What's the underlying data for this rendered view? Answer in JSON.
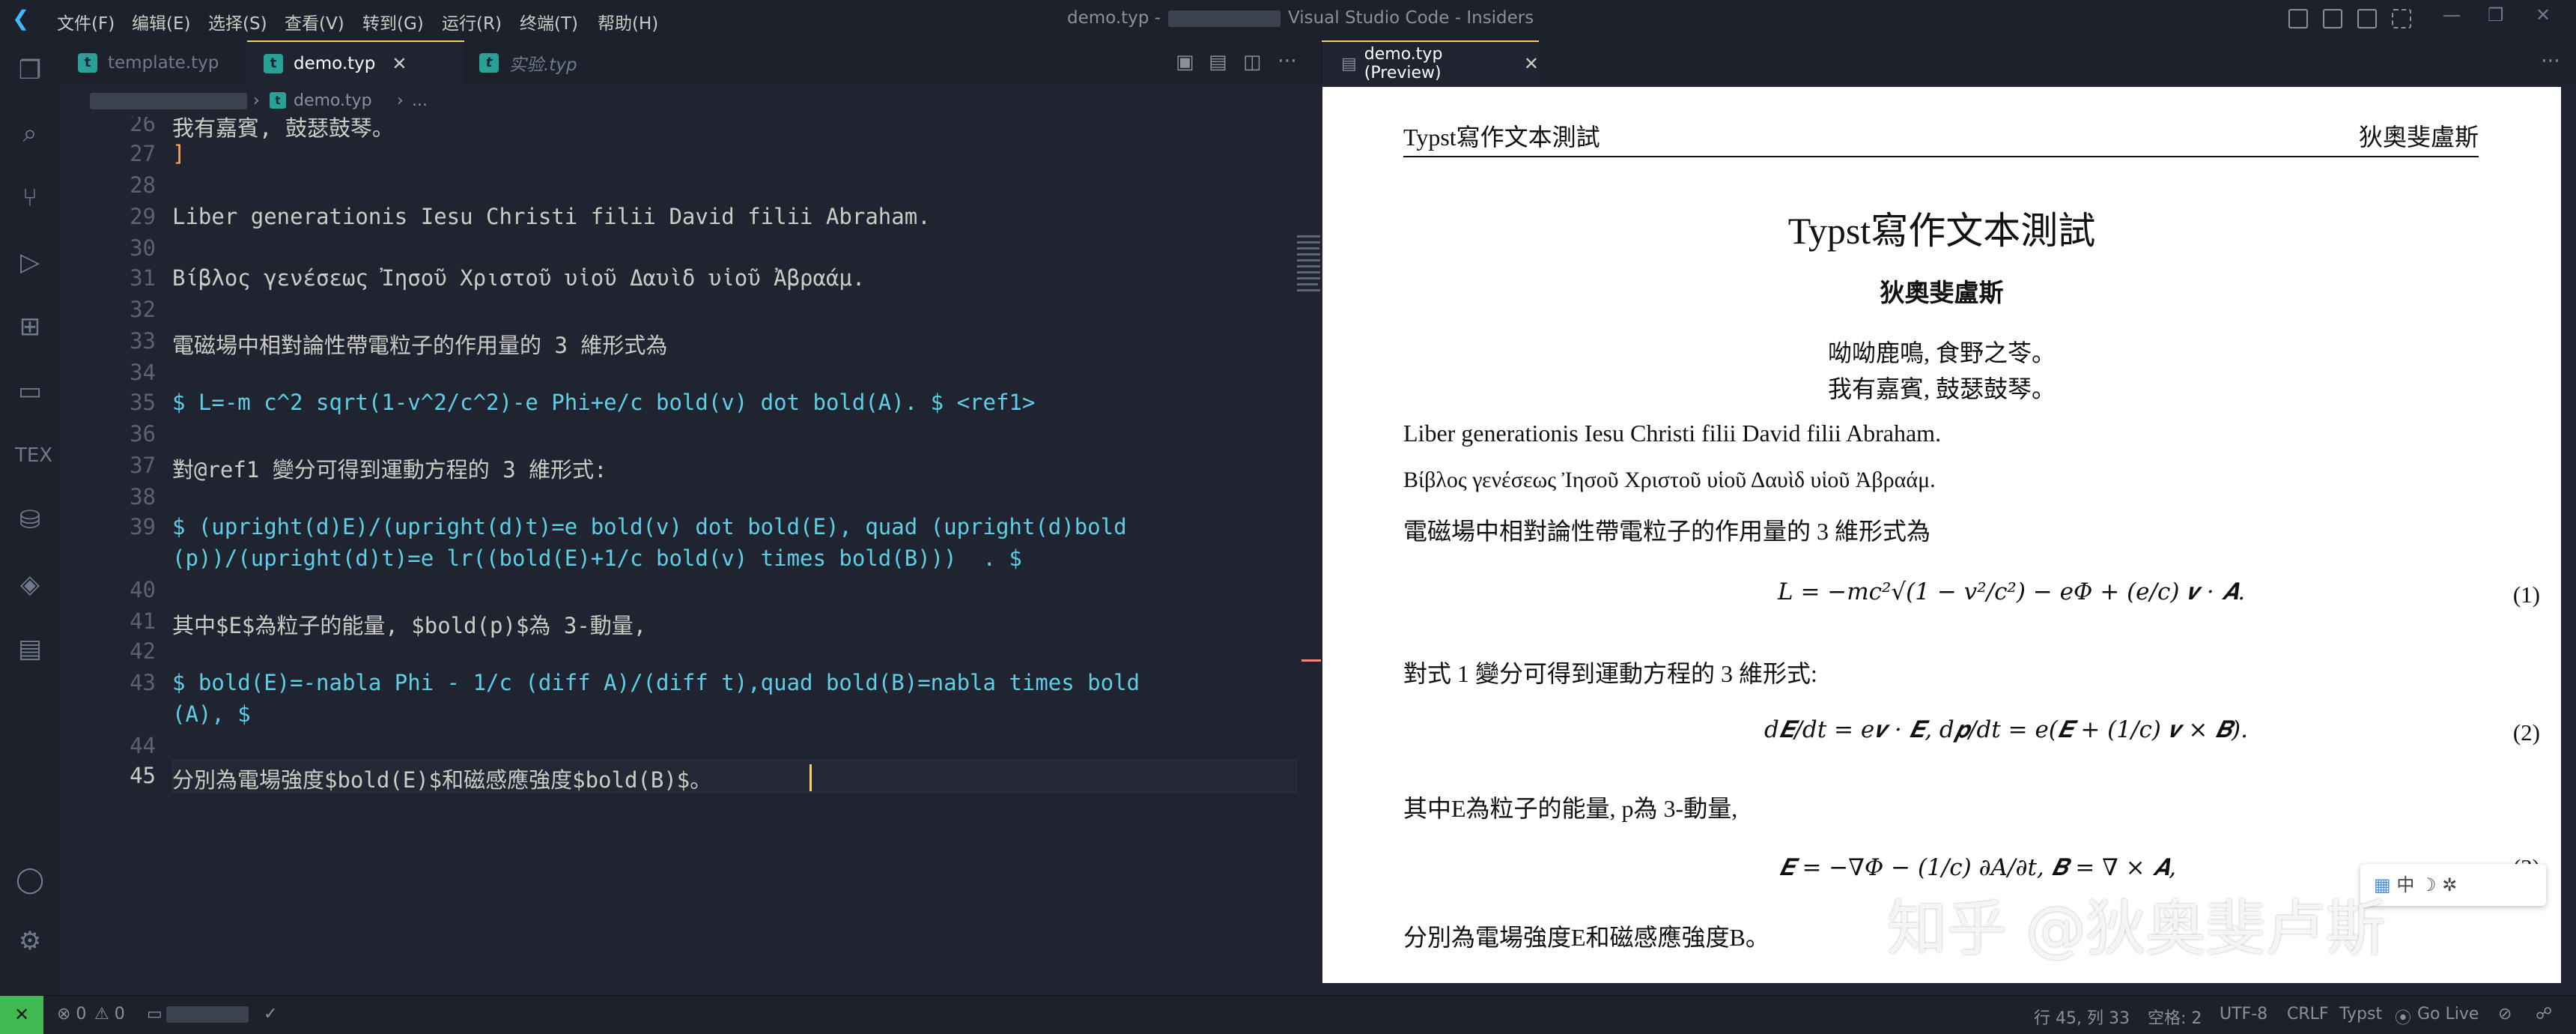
{
  "titlebar": {
    "menus": [
      "文件(F)",
      "编辑(E)",
      "选择(S)",
      "查看(V)",
      "转到(G)",
      "运行(R)",
      "终端(T)",
      "帮助(H)"
    ],
    "title_prefix": "demo.typ -",
    "title_suffix": "Visual Studio Code - Insiders"
  },
  "tabs": [
    {
      "label": "template.typ",
      "active": false,
      "italic": false
    },
    {
      "label": "demo.typ",
      "active": true,
      "italic": false
    },
    {
      "label": "实验.typ",
      "active": false,
      "italic": true
    }
  ],
  "breadcrumb": {
    "file": "demo.typ",
    "rest": "..."
  },
  "editor": {
    "lines": [
      {
        "n": "26",
        "text": "我有嘉賓, 鼓瑟鼓琴。"
      },
      {
        "n": "27",
        "text": "]"
      },
      {
        "n": "28",
        "text": ""
      },
      {
        "n": "29",
        "text": "Liber generationis Iesu Christi filii David filii Abraham."
      },
      {
        "n": "30",
        "text": ""
      },
      {
        "n": "31",
        "text": "Βίβλος γενέσεως Ἰησοῦ Χριστοῦ υἱοῦ Δαυὶδ υἱοῦ Ἀβραάμ."
      },
      {
        "n": "32",
        "text": ""
      },
      {
        "n": "33",
        "text": "電磁場中相對論性帶電粒子的作用量的 3 維形式為"
      },
      {
        "n": "34",
        "text": ""
      },
      {
        "n": "35",
        "text": "$ L=-m c^2 sqrt(1-v^2/c^2)-e Phi+e/c bold(v) dot bold(A). $ <ref1>"
      },
      {
        "n": "36",
        "text": ""
      },
      {
        "n": "37",
        "text": "對@ref1 變分可得到運動方程的 3 維形式:"
      },
      {
        "n": "38",
        "text": ""
      },
      {
        "n": "39",
        "text": "$ (upright(d)E)/(upright(d)t)=e bold(v) dot bold(E), quad (upright(d)bold"
      },
      {
        "n": "",
        "text": "(p))/(upright(d)t)=e lr((bold(E)+1/c bold(v) times bold(B)))  . $"
      },
      {
        "n": "40",
        "text": ""
      },
      {
        "n": "41",
        "text": "其中$E$為粒子的能量, $bold(p)$為 3-動量,"
      },
      {
        "n": "42",
        "text": ""
      },
      {
        "n": "43",
        "text": "$ bold(E)=-nabla Phi - 1/c (diff A)/(diff t),quad bold(B)=nabla times bold"
      },
      {
        "n": "",
        "text": "(A), $"
      },
      {
        "n": "44",
        "text": ""
      },
      {
        "n": "45",
        "text": "分別為電場強度$bold(E)$和磁感應強度$bold(B)$。"
      }
    ]
  },
  "preview": {
    "tab_label": "demo.typ (Preview)",
    "header_left": "Typst寫作文本測試",
    "header_right": "狄奧斐盧斯",
    "title": "Typst寫作文本測試",
    "author": "狄奧斐盧斯",
    "poem": [
      "呦呦鹿鳴, 食野之苓。",
      "我有嘉賓, 鼓瑟鼓琴。"
    ],
    "latin": "Liber generationis Iesu Christi filii David filii Abraham.",
    "greek": "Βίβλος γενέσεως Ἰησοῦ Χριστοῦ υἱοῦ Δαυὶδ υἱοῦ Ἀβραάμ.",
    "para1": "電磁場中相對論性帶電粒子的作用量的 3 維形式為",
    "eq1": "L = −mc²√(1 − v²/c²) − eΦ + (e/c) 𝒗 · 𝑨.",
    "eq1_num": "(1)",
    "para2": "對式 1 變分可得到運動方程的 3 維形式:",
    "eq2": "d𝑬/dt = e𝒗 · 𝑬,   d𝒑/dt = e(𝑬 + (1/c) 𝒗 × 𝑩).",
    "eq2_num": "(2)",
    "para3": "其中E為粒子的能量, p為 3-動量,",
    "eq3": "𝑬 = −∇Φ − (1/c) ∂A/∂t,   𝑩 = ∇ × 𝑨,",
    "eq3_num": "(3)",
    "para4": "分別為電場強度E和磁感應強度B。"
  },
  "overlay": {
    "watermark": "知乎 @狄奥斐卢斯",
    "ime_lang": "中"
  },
  "statusbar": {
    "errors": "⊗ 0",
    "warnings": "⚠ 0",
    "position": "行 45, 列 33",
    "spaces": "空格: 2",
    "encoding": "UTF-8",
    "eol": "CRLF",
    "language": "Typst",
    "golive": "Go Live"
  }
}
